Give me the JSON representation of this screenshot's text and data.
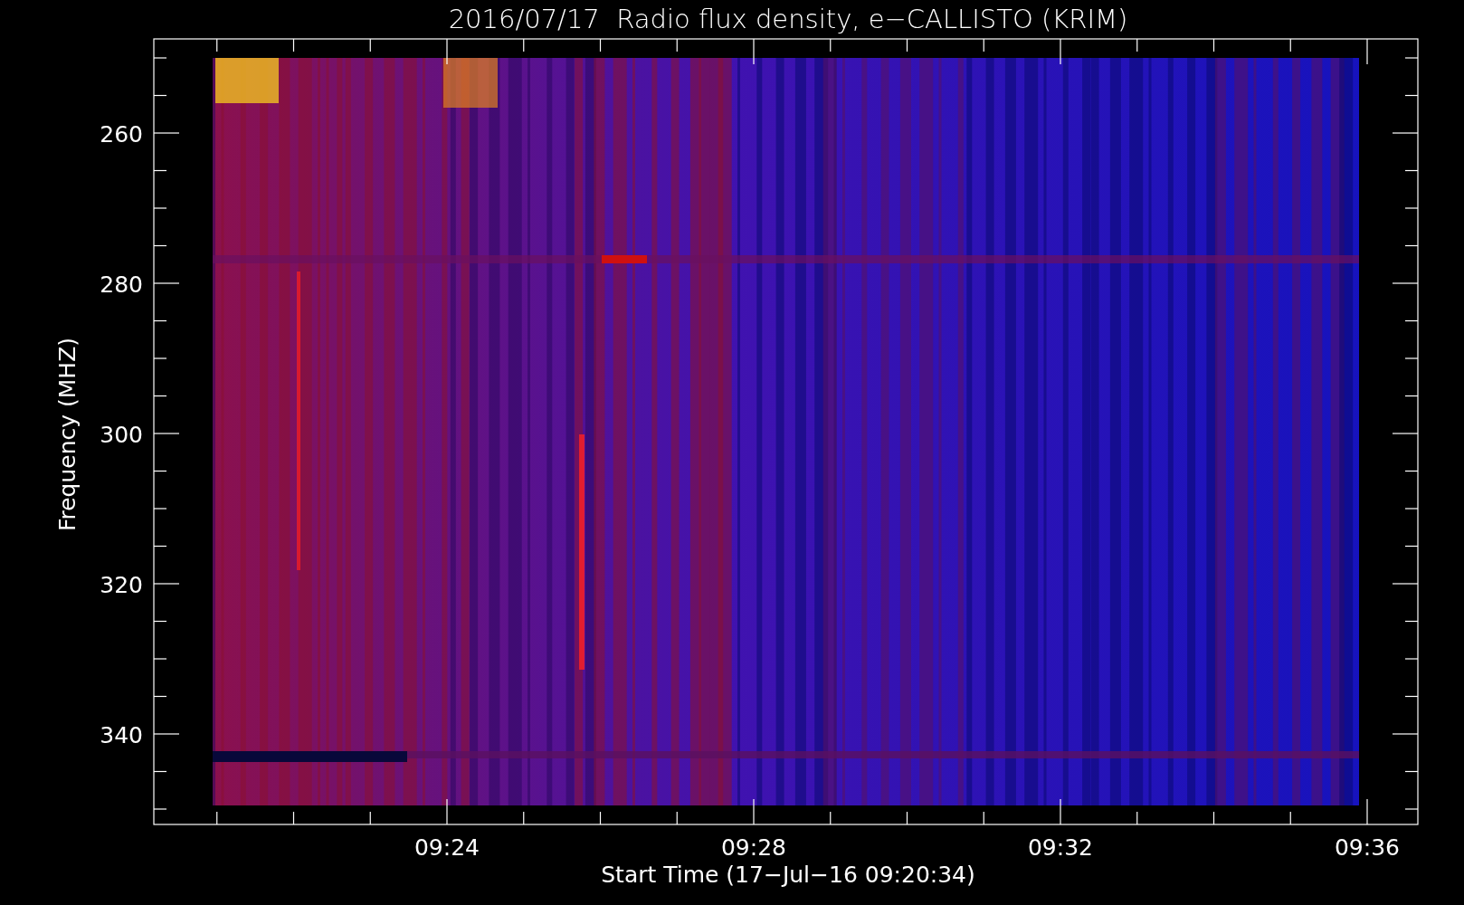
{
  "plot": {
    "title": "2016/07/17  Radio flux density, e−CALLISTO (KRIM)",
    "y_axis": {
      "label": "Frequency (MHZ)",
      "ticks": [
        "260",
        "280",
        "300",
        "320",
        "340"
      ]
    },
    "x_axis": {
      "label": "Start Time (17−Jul−16 09:20:34)",
      "ticks": [
        "09:24",
        "09:28",
        "09:32",
        "09:36"
      ]
    }
  }
}
